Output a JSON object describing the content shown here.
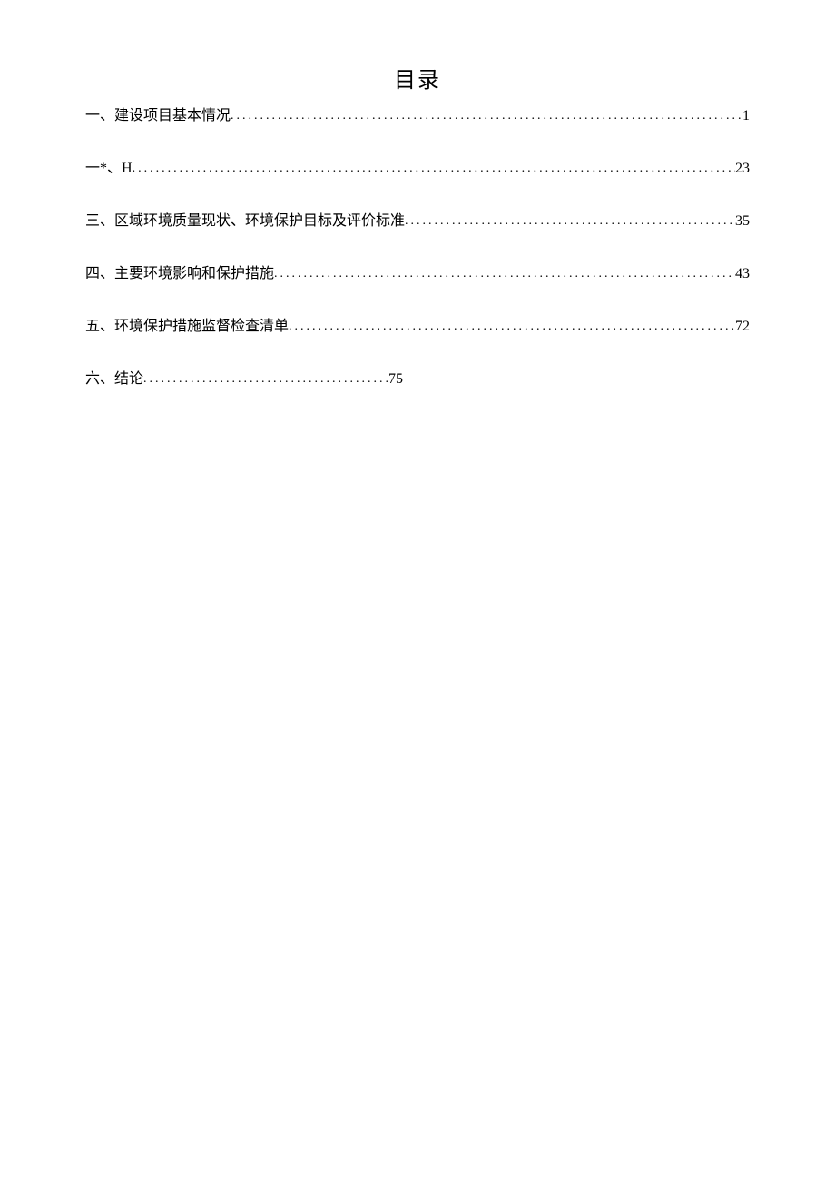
{
  "title": "目录",
  "toc": [
    {
      "label": "一、建设项目基本情况",
      "page": "1"
    },
    {
      "label": "一*、H",
      "page": "23"
    },
    {
      "label": "三、区域环境质量现状、环境保护目标及评价标准",
      "page": "35"
    },
    {
      "label": "四、主要环境影响和保护措施",
      "page": "43"
    },
    {
      "label": "五、环境保护措施监督检查清单",
      "page": "72"
    },
    {
      "label": "六、结论",
      "page": "75"
    }
  ]
}
